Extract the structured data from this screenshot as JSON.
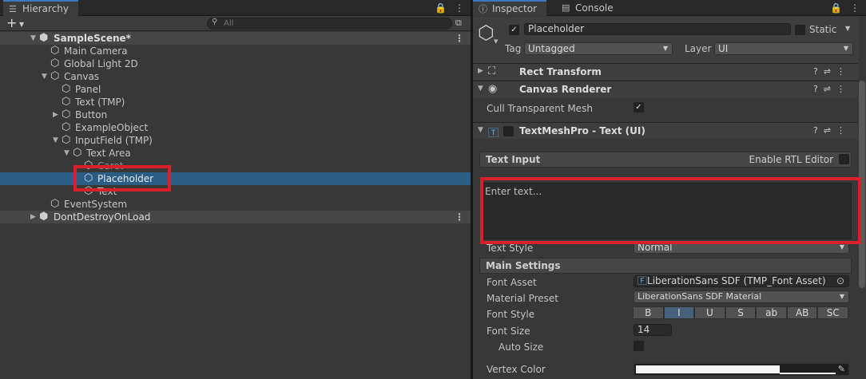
{
  "hierarchy": {
    "tab_label": "Hierarchy",
    "search_placeholder": "All",
    "add_label": "+",
    "rows": [
      {
        "label": "SampleScene*",
        "depth": 0,
        "expanded": true,
        "scene": true
      },
      {
        "label": "Main Camera",
        "depth": 1
      },
      {
        "label": "Global Light 2D",
        "depth": 1
      },
      {
        "label": "Canvas",
        "depth": 1,
        "expanded": true
      },
      {
        "label": "Panel",
        "depth": 2
      },
      {
        "label": "Text (TMP)",
        "depth": 2
      },
      {
        "label": "Button",
        "depth": 2,
        "collapsed": true
      },
      {
        "label": "ExampleObject",
        "depth": 2
      },
      {
        "label": "InputField (TMP)",
        "depth": 2,
        "expanded": true
      },
      {
        "label": "Text Area",
        "depth": 3,
        "expanded": true
      },
      {
        "label": "Caret",
        "depth": 4,
        "dim": true
      },
      {
        "label": "Placeholder",
        "depth": 4,
        "selected": true
      },
      {
        "label": "Text",
        "depth": 4
      },
      {
        "label": "EventSystem",
        "depth": 1
      },
      {
        "label": "DontDestroyOnLoad",
        "depth": 0,
        "collapsed": true,
        "scene": true
      }
    ]
  },
  "inspector": {
    "tab_label": "Inspector",
    "console_tab_label": "Console",
    "object_name": "Placeholder",
    "static_label": "Static",
    "tag_label": "Tag",
    "tag_value": "Untagged",
    "layer_label": "Layer",
    "layer_value": "UI",
    "components": {
      "rect_transform": "Rect Transform",
      "canvas_renderer": "Canvas Renderer",
      "tmp": "TextMeshPro - Text (UI)"
    },
    "cull_label": "Cull Transparent Mesh",
    "text_input_label": "Text Input",
    "rtl_label": "Enable RTL Editor",
    "text_value": "Enter text...",
    "text_style_label": "Text Style",
    "text_style_value": "Normal",
    "main_settings_label": "Main Settings",
    "font_asset_label": "Font Asset",
    "font_asset_value": "LiberationSans SDF (TMP_Font Asset)",
    "material_preset_label": "Material Preset",
    "material_preset_value": "LiberationSans SDF Material",
    "font_style_label": "Font Style",
    "font_style_buttons": [
      "B",
      "I",
      "U",
      "S",
      "ab",
      "AB",
      "SC"
    ],
    "font_size_label": "Font Size",
    "font_size_value": "14",
    "auto_size_label": "Auto Size",
    "vertex_color_label": "Vertex Color"
  },
  "colors": {
    "selection": "#2c5d87",
    "highlight_box": "#d9202a",
    "active_tab": "#3a79bb"
  }
}
